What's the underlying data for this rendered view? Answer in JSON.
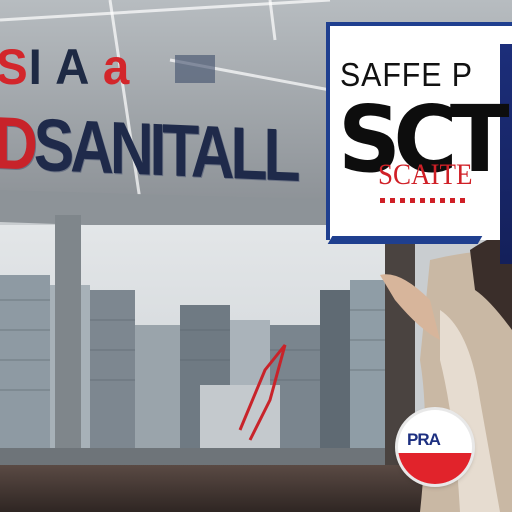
{
  "sign_top_left": {
    "red_part": "S",
    "rest": "I A",
    "red_tail": "a"
  },
  "sign_main": {
    "red_part": "D",
    "rest": "SANITALL"
  },
  "panel": {
    "top_line": "SAFFE P",
    "big_line": "SCT",
    "red_line": "SCAITE"
  },
  "badge": {
    "text": "PRA"
  },
  "colors": {
    "brand_red": "#d3262b",
    "navy": "#1f2a4a",
    "panel_blue": "#1f3f8f"
  }
}
